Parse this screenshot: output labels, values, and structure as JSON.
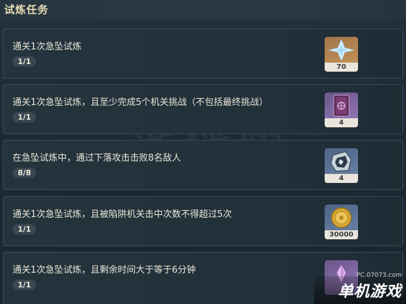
{
  "header": {
    "title": "试炼任务"
  },
  "tasks": [
    {
      "description": "通关1次急坠试炼",
      "progress": "1/1",
      "reward": {
        "icon": "primogem-icon",
        "count": "70",
        "color": "#c9985a"
      }
    },
    {
      "description": "通关1次急坠试炼，且至少完成5个机关挑战（不包括最终挑战）",
      "progress": "1/1",
      "reward": {
        "icon": "heros-wit-book-icon",
        "count": "4",
        "color": "#9a7cc0"
      }
    },
    {
      "description": "在急坠试炼中，通过下落攻击击败8名敌人",
      "progress": "8/8",
      "reward": {
        "icon": "mystic-enhancement-ore-icon",
        "count": "4",
        "color": "#6d86a8"
      }
    },
    {
      "description": "通关1次急坠试炼，且被陷阱机关击中次数不得超过5次",
      "progress": "1/1",
      "reward": {
        "icon": "mora-coin-icon",
        "count": "30000",
        "color": "#6d86a8"
      }
    },
    {
      "description": "通关1次急坠试炼，且剩余时间大于等于6分钟",
      "progress": "1/1",
      "reward": {
        "icon": "crystal-icon",
        "count": "",
        "color": "#9a7cc0"
      }
    }
  ],
  "watermark": "游侠网",
  "branding": {
    "site": "PC.07073.com",
    "logo": "单机游戏"
  }
}
